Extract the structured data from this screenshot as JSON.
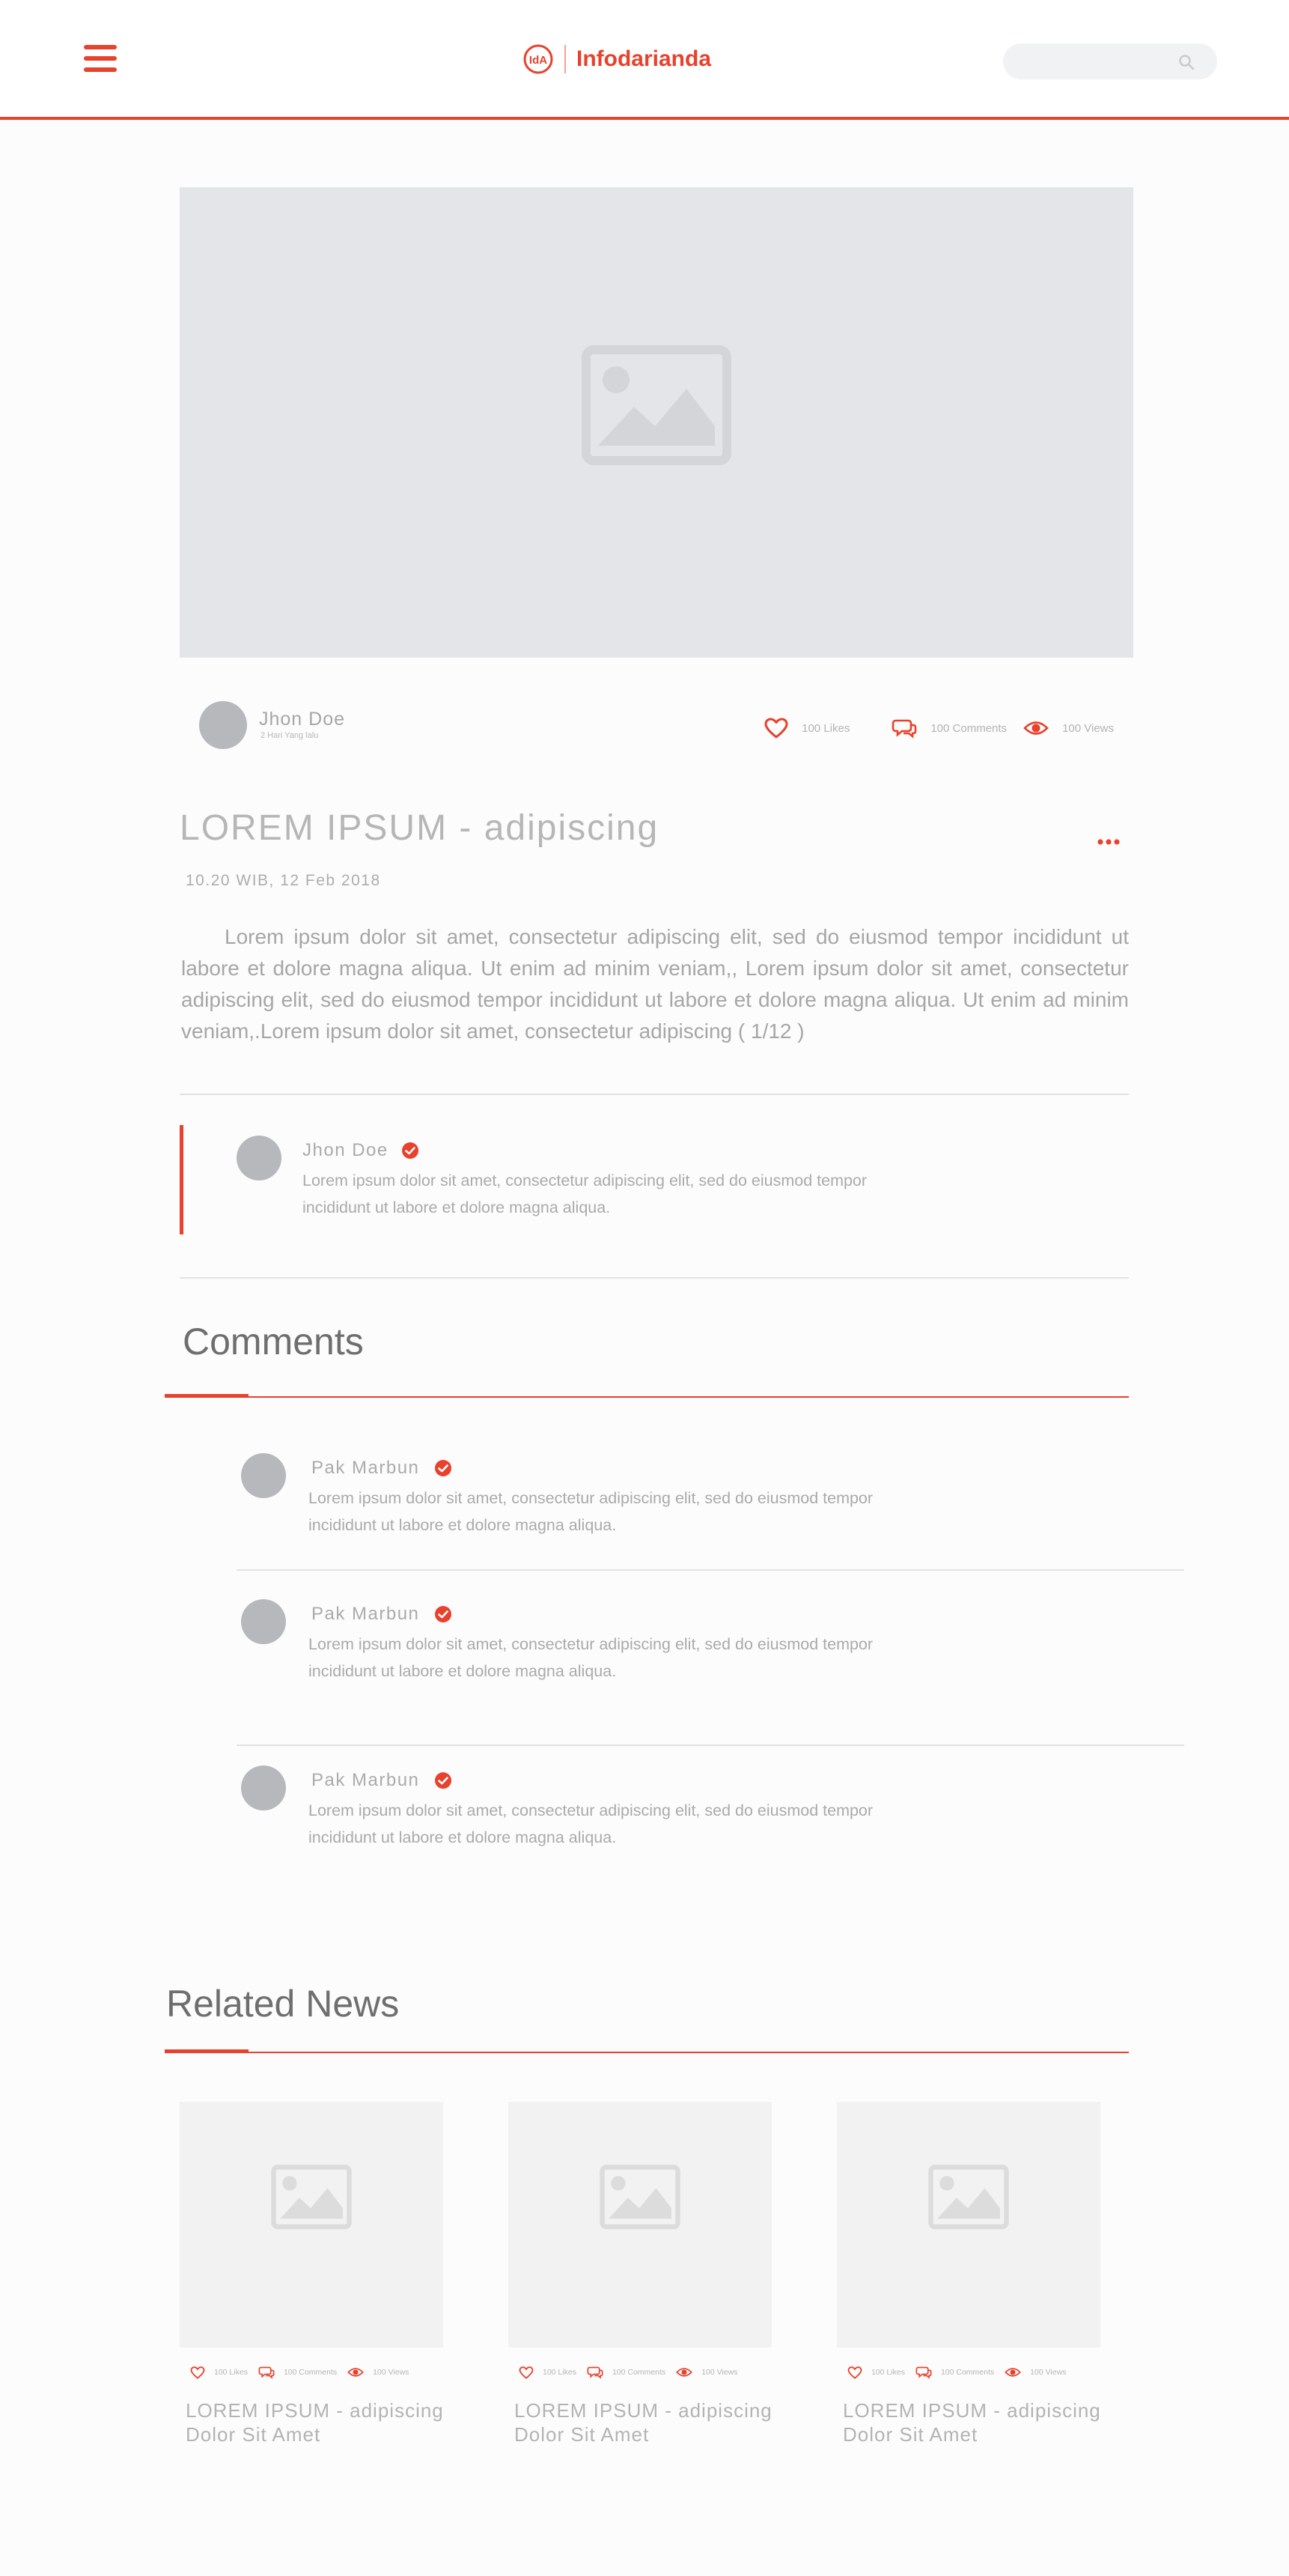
{
  "header": {
    "brand": "Infodarianda",
    "logo_initials": "IdA",
    "search_placeholder": ""
  },
  "post": {
    "author": "Jhon Doe",
    "time_ago": "2 Hari Yang lalu",
    "likes": "100 Likes",
    "comments": "100 Comments",
    "views": "100 Views",
    "title": "LOREM IPSUM - adipiscing",
    "date": "10.20 WIB, 12 Feb 2018",
    "body": "Lorem ipsum dolor sit amet, consectetur adipiscing elit, sed do eiusmod tempor incididunt ut labore et dolore magna aliqua. Ut enim ad minim veniam,, Lorem ipsum dolor sit amet, consectetur adipiscing elit, sed do eiusmod tempor incididunt ut labore et dolore magna aliqua. Ut enim ad minim veniam,.Lorem ipsum dolor sit amet, consectetur adipiscing  ( 1/12 )"
  },
  "quote": {
    "author": "Jhon Doe",
    "text": "Lorem ipsum dolor sit amet, consectetur adipiscing elit, sed do eiusmod tempor incididunt ut labore et dolore magna aliqua."
  },
  "comments_section": {
    "title": "Comments",
    "items": [
      {
        "name": "Pak Marbun",
        "text": "Lorem ipsum dolor sit amet, consectetur adipiscing elit, sed do eiusmod tempor incididunt ut labore et dolore magna aliqua."
      },
      {
        "name": "Pak Marbun",
        "text": "Lorem ipsum dolor sit amet, consectetur adipiscing elit, sed do eiusmod tempor incididunt ut labore et dolore magna aliqua."
      },
      {
        "name": "Pak Marbun",
        "text": "Lorem ipsum dolor sit amet, consectetur adipiscing elit, sed do eiusmod tempor incididunt ut labore et dolore magna aliqua."
      }
    ]
  },
  "related": {
    "title": "Related News",
    "cards": [
      {
        "title": "LOREM IPSUM - adipiscing Dolor Sit Amet",
        "likes": "100 Likes",
        "comments": "100 Comments",
        "views": "100 Views"
      },
      {
        "title": "LOREM IPSUM - adipiscing Dolor Sit Amet",
        "likes": "100 Likes",
        "comments": "100 Comments",
        "views": "100 Views"
      },
      {
        "title": "LOREM IPSUM - adipiscing Dolor Sit Amet",
        "likes": "100 Likes",
        "comments": "100 Comments",
        "views": "100 Views"
      }
    ]
  },
  "colors": {
    "accent": "#e8412c",
    "placeholder": "#e3e5e8",
    "avatar": "#b7b8bc"
  },
  "icons": {
    "menu": "hamburger-icon",
    "search": "search-icon",
    "image": "image-placeholder-icon",
    "like": "heart-icon",
    "comment": "comment-icon",
    "view": "eye-icon",
    "more": "more-dots-icon",
    "verified": "verified-check-icon"
  }
}
